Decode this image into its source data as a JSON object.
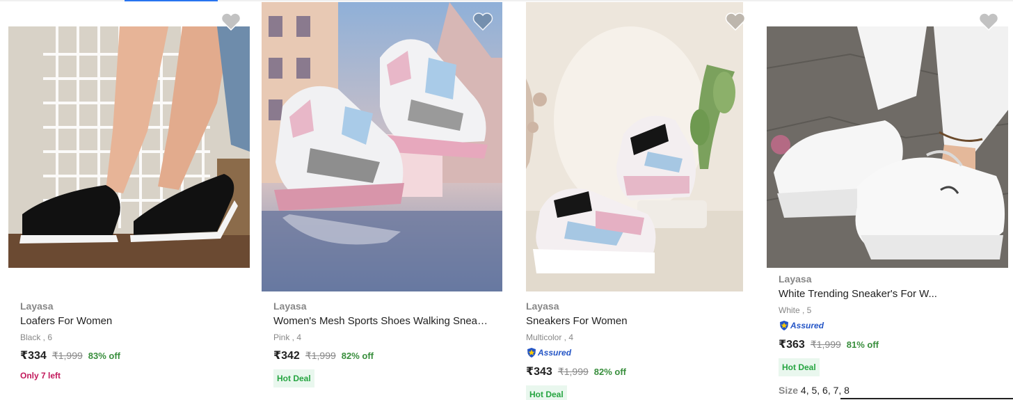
{
  "products": [
    {
      "brand": "Layasa",
      "title": "Loafers For Women",
      "variant": "Black , 6",
      "price": "₹334",
      "mrp": "₹1,999",
      "discount": "83% off",
      "stock_note": "Only 7 left",
      "image_icon": "black-loafers-image",
      "wishlist_icon": "heart-icon"
    },
    {
      "brand": "Layasa",
      "title": "Women's Mesh Sports Shoes Walking Sneak...",
      "variant": "Pink , 4",
      "price": "₹342",
      "mrp": "₹1,999",
      "discount": "82% off",
      "badge": "Hot Deal",
      "image_icon": "pink-sneakers-image",
      "wishlist_icon": "heart-icon"
    },
    {
      "brand": "Layasa",
      "title": "Sneakers For Women",
      "variant": "Multicolor , 4",
      "assured": "Assured",
      "price": "₹343",
      "mrp": "₹1,999",
      "discount": "82% off",
      "badge": "Hot Deal",
      "image_icon": "multicolor-sneakers-image",
      "wishlist_icon": "heart-icon"
    },
    {
      "brand": "Layasa",
      "title": "White Trending Sneaker's For W...",
      "variant": "White , 5",
      "assured": "Assured",
      "price": "₹363",
      "mrp": "₹1,999",
      "discount": "81% off",
      "badge": "Hot Deal",
      "sizes_label": "Size",
      "sizes": "4, 5, 6, 7, 8",
      "image_icon": "white-chunky-sneakers-image",
      "wishlist_icon": "heart-icon"
    }
  ],
  "colors": {
    "accent": "#2874f0",
    "discount": "#388e3c",
    "stock": "#c2185b",
    "assured": "#2455c6",
    "hot_deal_bg": "#e9f7ee",
    "hot_deal_text": "#26a541"
  }
}
